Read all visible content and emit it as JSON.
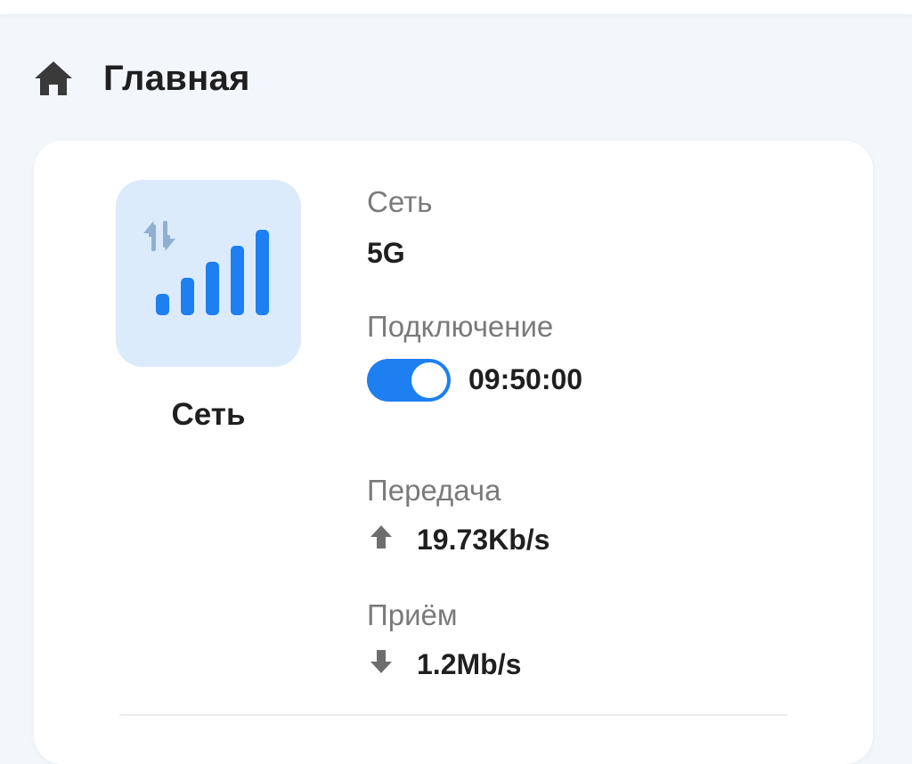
{
  "header": {
    "title": "Главная",
    "icon": "home-icon"
  },
  "network_tile": {
    "icon": "signal-bars-icon",
    "label": "Сеть",
    "accent_color": "#1e7ff0",
    "tile_color": "#dcebfc"
  },
  "network": {
    "label": "Сеть",
    "value": "5G"
  },
  "connection": {
    "label": "Подключение",
    "toggle_on": true,
    "duration": "09:50:00"
  },
  "upload": {
    "label": "Передача",
    "icon": "arrow-up-icon",
    "value": "19.73Kb/s"
  },
  "download": {
    "label": "Приём",
    "icon": "arrow-down-icon",
    "value": "1.2Mb/s"
  }
}
